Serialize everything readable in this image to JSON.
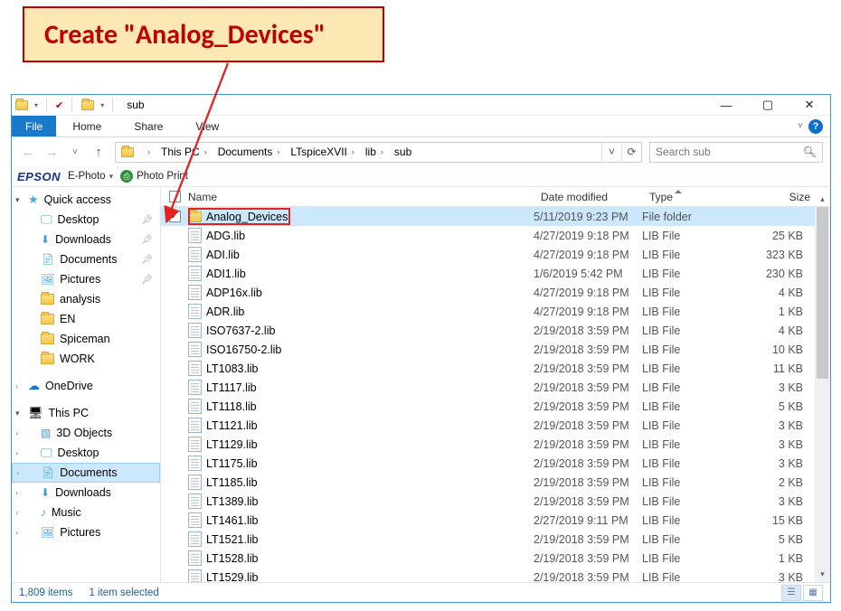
{
  "annotation": {
    "text": "Create \"Analog_Devices\""
  },
  "titlebar": {
    "title": "sub"
  },
  "menubar": {
    "file": "File",
    "tabs": [
      "Home",
      "Share",
      "View"
    ]
  },
  "addressbar": {
    "segments": [
      "This PC",
      "Documents",
      "LTspiceXVII",
      "lib",
      "sub"
    ],
    "search_placeholder": "Search sub"
  },
  "epson": {
    "logo": "EPSON",
    "ephoto": "E-Photo",
    "photoprint": "Photo Print"
  },
  "columns": {
    "name": "Name",
    "date": "Date modified",
    "type": "Type",
    "size": "Size"
  },
  "nav": {
    "quick": {
      "label": "Quick access",
      "items": [
        {
          "label": "Desktop",
          "pin": true,
          "icon": "desktop"
        },
        {
          "label": "Downloads",
          "pin": true,
          "icon": "downloads"
        },
        {
          "label": "Documents",
          "pin": true,
          "icon": "documents"
        },
        {
          "label": "Pictures",
          "pin": true,
          "icon": "pictures"
        },
        {
          "label": "analysis",
          "pin": false,
          "icon": "folder"
        },
        {
          "label": "EN",
          "pin": false,
          "icon": "folder"
        },
        {
          "label": "Spiceman",
          "pin": false,
          "icon": "folder"
        },
        {
          "label": "WORK",
          "pin": false,
          "icon": "folder"
        }
      ]
    },
    "onedrive": {
      "label": "OneDrive"
    },
    "thispc": {
      "label": "This PC",
      "items": [
        {
          "label": "3D Objects",
          "icon": "3d"
        },
        {
          "label": "Desktop",
          "icon": "desktop"
        },
        {
          "label": "Documents",
          "icon": "documents",
          "selected": true
        },
        {
          "label": "Downloads",
          "icon": "downloads"
        },
        {
          "label": "Music",
          "icon": "music"
        },
        {
          "label": "Pictures",
          "icon": "pictures"
        }
      ]
    }
  },
  "files": [
    {
      "name": "Analog_Devices",
      "date": "5/11/2019 9:23 PM",
      "type": "File folder",
      "size": "",
      "kind": "folder",
      "selected": true
    },
    {
      "name": "ADG.lib",
      "date": "4/27/2019 9:18 PM",
      "type": "LIB File",
      "size": "25 KB",
      "kind": "file"
    },
    {
      "name": "ADI.lib",
      "date": "4/27/2019 9:18 PM",
      "type": "LIB File",
      "size": "323 KB",
      "kind": "file"
    },
    {
      "name": "ADI1.lib",
      "date": "1/6/2019 5:42 PM",
      "type": "LIB File",
      "size": "230 KB",
      "kind": "file"
    },
    {
      "name": "ADP16x.lib",
      "date": "4/27/2019 9:18 PM",
      "type": "LIB File",
      "size": "4 KB",
      "kind": "file"
    },
    {
      "name": "ADR.lib",
      "date": "4/27/2019 9:18 PM",
      "type": "LIB File",
      "size": "1 KB",
      "kind": "file"
    },
    {
      "name": "ISO7637-2.lib",
      "date": "2/19/2018 3:59 PM",
      "type": "LIB File",
      "size": "4 KB",
      "kind": "file"
    },
    {
      "name": "ISO16750-2.lib",
      "date": "2/19/2018 3:59 PM",
      "type": "LIB File",
      "size": "10 KB",
      "kind": "file"
    },
    {
      "name": "LT1083.lib",
      "date": "2/19/2018 3:59 PM",
      "type": "LIB File",
      "size": "11 KB",
      "kind": "file"
    },
    {
      "name": "LT1117.lib",
      "date": "2/19/2018 3:59 PM",
      "type": "LIB File",
      "size": "3 KB",
      "kind": "file"
    },
    {
      "name": "LT1118.lib",
      "date": "2/19/2018 3:59 PM",
      "type": "LIB File",
      "size": "5 KB",
      "kind": "file"
    },
    {
      "name": "LT1121.lib",
      "date": "2/19/2018 3:59 PM",
      "type": "LIB File",
      "size": "3 KB",
      "kind": "file"
    },
    {
      "name": "LT1129.lib",
      "date": "2/19/2018 3:59 PM",
      "type": "LIB File",
      "size": "3 KB",
      "kind": "file"
    },
    {
      "name": "LT1175.lib",
      "date": "2/19/2018 3:59 PM",
      "type": "LIB File",
      "size": "3 KB",
      "kind": "file"
    },
    {
      "name": "LT1185.lib",
      "date": "2/19/2018 3:59 PM",
      "type": "LIB File",
      "size": "2 KB",
      "kind": "file"
    },
    {
      "name": "LT1389.lib",
      "date": "2/19/2018 3:59 PM",
      "type": "LIB File",
      "size": "3 KB",
      "kind": "file"
    },
    {
      "name": "LT1461.lib",
      "date": "2/27/2019 9:11 PM",
      "type": "LIB File",
      "size": "15 KB",
      "kind": "file"
    },
    {
      "name": "LT1521.lib",
      "date": "2/19/2018 3:59 PM",
      "type": "LIB File",
      "size": "5 KB",
      "kind": "file"
    },
    {
      "name": "LT1528.lib",
      "date": "2/19/2018 3:59 PM",
      "type": "LIB File",
      "size": "1 KB",
      "kind": "file"
    },
    {
      "name": "LT1529.lib",
      "date": "2/19/2018 3:59 PM",
      "type": "LIB File",
      "size": "3 KB",
      "kind": "file"
    }
  ],
  "status": {
    "count": "1,809 items",
    "selected": "1 item selected"
  }
}
